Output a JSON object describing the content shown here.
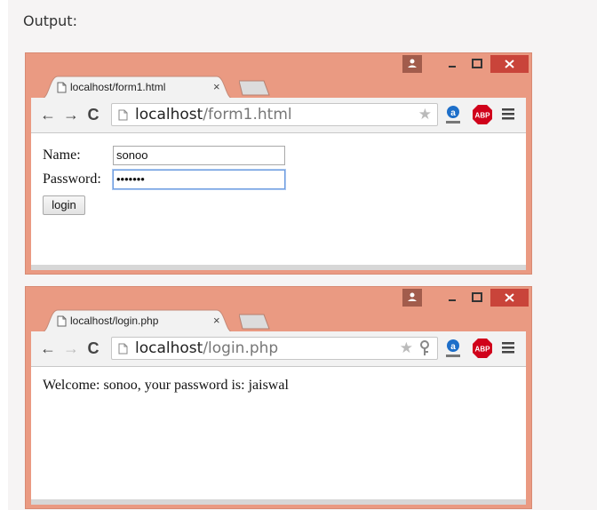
{
  "output_label": "Output:",
  "windows": [
    {
      "tab_title": "localhost/form1.html",
      "tab_close": "×",
      "url_host": "localhost",
      "url_path": "/form1.html",
      "form": {
        "name_label": "Name:",
        "name_value": "sonoo",
        "password_label": "Password:",
        "password_value": "•••••••",
        "submit_label": "login"
      }
    },
    {
      "tab_title": "localhost/login.php",
      "tab_close": "×",
      "url_host": "localhost",
      "url_path": "/login.php",
      "message": "Welcome: sonoo, your password is: jaiswal"
    }
  ],
  "icons": {
    "back": "←",
    "forward": "→",
    "reload": "C",
    "star": "★"
  },
  "colors": {
    "frame": "#ea9a82",
    "close_button": "#c9443a",
    "abp": "#d0021b",
    "ext_blue": "#1e6fc9"
  }
}
